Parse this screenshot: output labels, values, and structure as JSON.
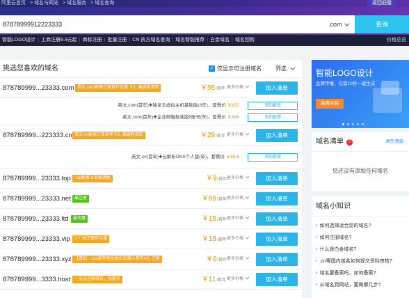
{
  "topbar": {
    "crumbs": [
      "阿里云首页",
      "> 域名与网站",
      "> 域名服务",
      "> 域名查询"
    ],
    "back_label": "返回旧版"
  },
  "search": {
    "value": "87878999912223333",
    "suffix": ".com",
    "query_label": "查询"
  },
  "nav": {
    "items": [
      "智能LOGO设计",
      "工商注册9.9元起",
      "商标注册",
      "批量注册",
      "CN 执方域名查询",
      "域名智能推荐",
      "白金域名",
      "域名回购"
    ],
    "right_label": "价格总览"
  },
  "main": {
    "title": "挑选您喜欢的域名",
    "avail_label": "仅显示可注册域名",
    "filter_label": "筛选",
    "more_label": "更多价格",
    "add_label": "加入清单",
    "rows": [
      {
        "name": "878789999...23333.com",
        "badge": "英文.com新客订单首年优惠 ￥1, 满减购清单",
        "badge_color": "orange",
        "price": "￥55",
        "unit": "/首年",
        "combos": [
          {
            "text": "英文.com(首年)",
            "plus": "✚",
            "item": "独享云虚拟主机基础版(3年)，套餐价",
            "price": "￥672",
            "btn": "添加套餐"
          },
          {
            "text": "英文.com(首年)",
            "plus": "✚",
            "item": "企业邮箱标准版5账号(年)，套餐价",
            "price": "￥668",
            "btn": "添加套餐"
          }
        ]
      },
      {
        "name": "878789999...223333.cn",
        "badge": "英文.cn新客订单首年￥5, 满减购清单",
        "badge_color": "orange",
        "price": "￥29",
        "unit": "/首年",
        "combos": [
          {
            "text": "英文.cn(首年)",
            "plus": "✚",
            "item": "云解析DNS个人版(年)，套餐价",
            "price": "￥69.8",
            "btn": "添加套餐"
          }
        ]
      },
      {
        "name": "878789999...23333.top",
        "badge": ".top新客上首版满免",
        "badge_color": "orange",
        "price": "￥9",
        "unit": "/首年"
      },
      {
        "name": "878789999...23333.net",
        "badge": "最注册",
        "badge_color": "green",
        "price": "￥69",
        "unit": "/首年"
      },
      {
        "name": "878789999...23333.ltd",
        "badge": "最优惠",
        "badge_color": "green",
        "price": "￥15",
        "unit": "/首年"
      },
      {
        "name": "878789999...23333.vip",
        "badge": "3-7.26注册即优惠",
        "badge_color": "orange",
        "price": "￥18",
        "unit": "/首年"
      },
      {
        "name": "878789999...23333.xyz",
        "badge": "【双9】 .xyz首年特价续价仅需入首年4元 注册",
        "badge_color": "orange",
        "price": "￥6",
        "unit": "/首年"
      },
      {
        "name": "878789999...3333.host",
        "badge": "一览无全国域名，优惠多",
        "badge_color": "orange",
        "price": "￥11",
        "unit": "/首年"
      }
    ]
  },
  "promo": {
    "title": "智能LOGO设计",
    "subtitle": "品牌传播，仅需10秒一键生成",
    "button": "免费体验"
  },
  "cart": {
    "title": "域名清单",
    "count": "0",
    "clear_label": "清空清单",
    "empty_text": "您还没有添加任何域名"
  },
  "knowledge": {
    "title": "域名小知识",
    "items": [
      "如何选择适合您的域名?",
      "如何注册域名?",
      "什么是白金域名?",
      ".cn等国内域名如何提交资料审核?",
      "域名要备案吗，如何备案?",
      "从域名到网站，要做哪几步?"
    ]
  }
}
